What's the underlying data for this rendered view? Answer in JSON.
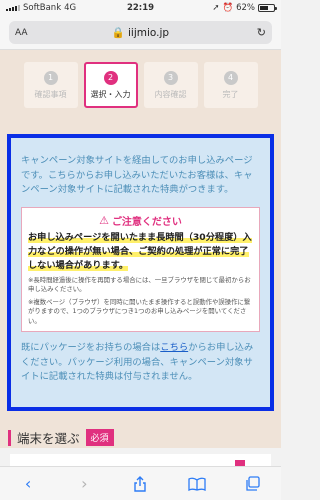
{
  "status_bar": {
    "carrier": "SoftBank",
    "network": "4G",
    "time": "22:19",
    "battery": "62%",
    "battery_level": 0.62
  },
  "browser": {
    "aa_label": "AA",
    "url": "iijmio.jp"
  },
  "steps": [
    {
      "num": "1",
      "label": "確認事項",
      "active": false
    },
    {
      "num": "2",
      "label": "選択・入力",
      "active": true
    },
    {
      "num": "3",
      "label": "内容確認",
      "active": false
    },
    {
      "num": "4",
      "label": "完了",
      "active": false
    }
  ],
  "notice": {
    "intro": "キャンペーン対象サイトを経由してのお申し込みページです。こちらからお申し込みいただいたお客様は、キャンペーン対象サイトに記載された特典がつきます。",
    "caution_title": "ご注意ください",
    "caution_strong": "お申し込みページを開いたまま長時間（30分程度）入力などの操作が無い場合、ご契約の処理が正常に完了しない場合があります。",
    "caution_note_1": "※長時間経過後に操作を再開する場合には、一旦ブラウザを閉じて最初からお申し込みください。",
    "caution_note_2": "※複数ページ（ブラウザ）を同時に開いたまま操作すると誤動作や誤操作に繋がりますので、1つのブラウザにつき1つのお申し込みページを開いてください。",
    "outro_before": "既にパッケージをお持ちの場合は",
    "outro_link": "こちら",
    "outro_after": "からお申し込みください。パッケージ利用の場合、キャンペーン対象サイトに記載された特典は付与されません。"
  },
  "section": {
    "title": "端末を選ぶ",
    "badge": "必須"
  },
  "colors": {
    "accent": "#e0307f",
    "frame": "#0a2ee6",
    "notice_bg": "#d3e6f5",
    "ios_blue": "#2d7cf6"
  },
  "toolbar_icons": [
    "back-icon",
    "forward-icon",
    "share-icon",
    "bookmarks-icon",
    "tabs-icon"
  ]
}
